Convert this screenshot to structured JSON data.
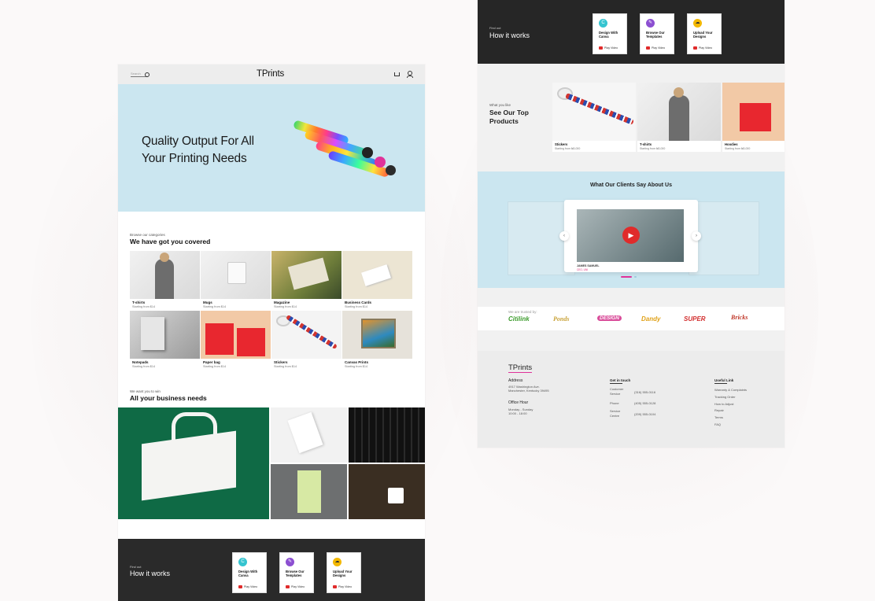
{
  "left_page": {
    "nav": {
      "search_placeholder": "Search",
      "logo": "TPrints"
    },
    "hero": {
      "title_line1": "Quality Output For All",
      "title_line2": "Your Printing Needs"
    },
    "categories": {
      "subtitle": "Browse our categories",
      "title": "We have got you covered",
      "items": [
        {
          "name": "T-shirts",
          "price": "Starting from $14"
        },
        {
          "name": "Mugs",
          "price": "Starting from $14"
        },
        {
          "name": "Magazine",
          "price": "Starting from $14"
        },
        {
          "name": "Business Cards",
          "price": "Starting from $14"
        },
        {
          "name": "Notepads",
          "price": "Starting from $14"
        },
        {
          "name": "Paper bag",
          "price": "Starting from $14"
        },
        {
          "name": "Stickers",
          "price": "Starting from $14"
        },
        {
          "name": "Canvas Prints",
          "price": "Starting from $14"
        }
      ]
    },
    "business": {
      "subtitle": "We want you to win",
      "title": "All your business needs"
    },
    "how": {
      "subtitle": "Find out",
      "title": "How it works",
      "cards": [
        {
          "label": "Design With Canva",
          "icon": "canva-icon",
          "color": "#35c4d0",
          "action": "Play Video"
        },
        {
          "label": "Browse Our Templates",
          "icon": "template-icon",
          "color": "#8c4fd1",
          "action": "Play Video"
        },
        {
          "label": "Upload Your Designs",
          "icon": "upload-icon",
          "color": "#f3b800",
          "action": "Play Video"
        }
      ]
    }
  },
  "right_page": {
    "how": {
      "subtitle": "Find out",
      "title": "How it works",
      "cards": [
        {
          "label": "Design With Canva",
          "icon": "canva-icon",
          "color": "#35c4d0",
          "action": "Play Video"
        },
        {
          "label": "Browse Our Templates",
          "icon": "template-icon",
          "color": "#8c4fd1",
          "action": "Play Video"
        },
        {
          "label": "Upload Your Designs",
          "icon": "upload-icon",
          "color": "#f3b800",
          "action": "Play Video"
        }
      ]
    },
    "top_products": {
      "subtitle": "What you like",
      "title_line1": "See Our Top",
      "title_line2": "Products",
      "items": [
        {
          "name": "Stickers",
          "price": "Starting from ₦3,000"
        },
        {
          "name": "T-shirts",
          "price": "Starting from ₦3,000"
        },
        {
          "name": "Hoodies",
          "price": "Starting from ₦3,000"
        }
      ]
    },
    "testimonials": {
      "title": "What Our Clients Say About Us",
      "name": "JAMES SAMUEL",
      "role": "CEO, UNI"
    },
    "trusted": {
      "label": "We are trusted by:",
      "brands": [
        {
          "name": "Citilink",
          "color": "#3a9a2a"
        },
        {
          "name": "Ponds",
          "color": "#c9a33a"
        },
        {
          "name": "DESIGN",
          "color": "#d94d9a"
        },
        {
          "name": "Dandy",
          "color": "#e0a21a"
        },
        {
          "name": "SUPER",
          "color": "#d22c2c"
        },
        {
          "name": "Bricks",
          "color": "#c0392b"
        }
      ]
    },
    "footer": {
      "logo": "TPrints",
      "address_label": "Address",
      "address_line1": "4917 Washington Ave.",
      "address_line2": "Manchester, Kentucky 39495",
      "hours_label": "Office Hour",
      "hours_line1": "Monday - Sunday",
      "hours_line2": "10:00 - 18:00",
      "contact_label": "Get in touch",
      "contacts": [
        {
          "k1": "Customer",
          "k2": "Service",
          "v": "(316) 555-0116"
        },
        {
          "k1": "Phone",
          "k2": "",
          "v": "(405) 555-0128"
        },
        {
          "k1": "Service",
          "k2": "Centre",
          "v": "(209) 555-0104"
        }
      ],
      "links_label": "Useful Link",
      "links": [
        "Warranty & Complaints",
        "Tracking Order",
        "How to Adjust",
        "Repair",
        "Terms",
        "FAQ"
      ]
    }
  }
}
